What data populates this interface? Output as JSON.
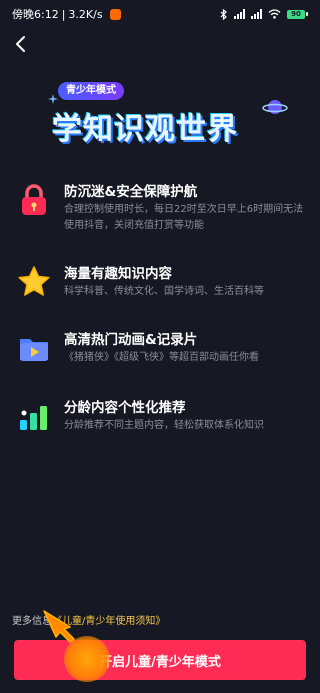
{
  "status_bar": {
    "time": "傍晚6:12",
    "network_speed": "3.2K/s",
    "battery": "90"
  },
  "hero": {
    "tag": "青少年模式",
    "title": "学知识观世界"
  },
  "features": [
    {
      "icon": "lock-icon",
      "title": "防沉迷&安全保障护航",
      "desc": "合理控制使用时长，每日22时至次日早上6时期间无法使用抖音，关闭充值打赏等功能"
    },
    {
      "icon": "star-icon",
      "title": "海量有趣知识内容",
      "desc": "科学科普、传统文化、国学诗词、生活百科等"
    },
    {
      "icon": "video-folder-icon",
      "title": "高清热门动画&记录片",
      "desc": "《猪猪侠》《超级飞侠》等超百部动画任你看"
    },
    {
      "icon": "bar-chart-icon",
      "title": "分龄内容个性化推荐",
      "desc": "分龄推荐不同主题内容，轻松获取体系化知识"
    }
  ],
  "footer": {
    "prefix": "更多信息",
    "link": "《儿童/青少年使用须知》"
  },
  "cta_label": "开启儿童/青少年模式",
  "colors": {
    "background": "#161823",
    "cta": "#fe2c55",
    "link": "#f6c64b"
  }
}
